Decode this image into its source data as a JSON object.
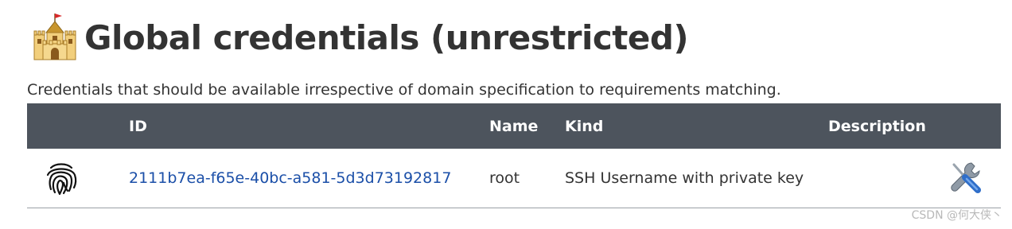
{
  "header": {
    "title": "Global credentials (unrestricted)",
    "icon": "castle-icon",
    "description": "Credentials that should be available irrespective of domain specification to requirements matching."
  },
  "table": {
    "columns": [
      "",
      "ID",
      "Name",
      "Kind",
      "Description",
      ""
    ],
    "rows": [
      {
        "icon": "fingerprint-icon",
        "id": "2111b7ea-f65e-40bc-a581-5d3d73192817",
        "name": "root",
        "kind": "SSH Username with private key",
        "description": "",
        "action_icon": "configure-tools-icon"
      }
    ]
  },
  "watermark": "CSDN @何大侠丶",
  "colors": {
    "header_bg": "#4d545d",
    "link": "#1b4fa8",
    "text": "#333333"
  }
}
